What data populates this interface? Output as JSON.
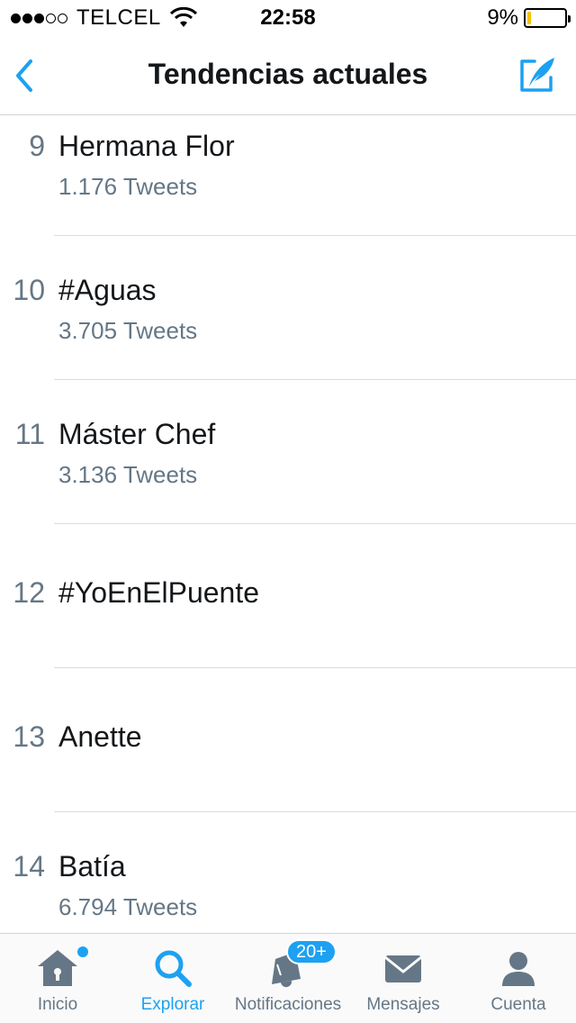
{
  "status_bar": {
    "carrier": "TELCEL",
    "time": "22:58",
    "battery_percent": "9%",
    "battery_level": 0.09,
    "signal_bars_filled": 3,
    "signal_bars_total": 5
  },
  "nav": {
    "title": "Tendencias actuales",
    "back_icon": "chevron-left-icon",
    "compose_icon": "compose-tweet-icon",
    "accent_color": "#1da1f2"
  },
  "trends": [
    {
      "rank": "9",
      "name": "Hermana Flor",
      "count": "1.176 Tweets"
    },
    {
      "rank": "10",
      "name": "#Aguas",
      "count": "3.705 Tweets"
    },
    {
      "rank": "11",
      "name": "Máster Chef",
      "count": "3.136 Tweets"
    },
    {
      "rank": "12",
      "name": "#YoEnElPuente",
      "count": ""
    },
    {
      "rank": "13",
      "name": "Anette",
      "count": ""
    },
    {
      "rank": "14",
      "name": "Batía",
      "count": "6.794 Tweets"
    }
  ],
  "tabs": [
    {
      "label": "Inicio",
      "icon": "home-icon",
      "active": false
    },
    {
      "label": "Explorar",
      "icon": "search-icon",
      "active": true
    },
    {
      "label": "Notificaciones",
      "icon": "bell-icon",
      "active": false,
      "badge": "20+"
    },
    {
      "label": "Mensajes",
      "icon": "envelope-icon",
      "active": false
    },
    {
      "label": "Cuenta",
      "icon": "person-icon",
      "active": false
    }
  ]
}
